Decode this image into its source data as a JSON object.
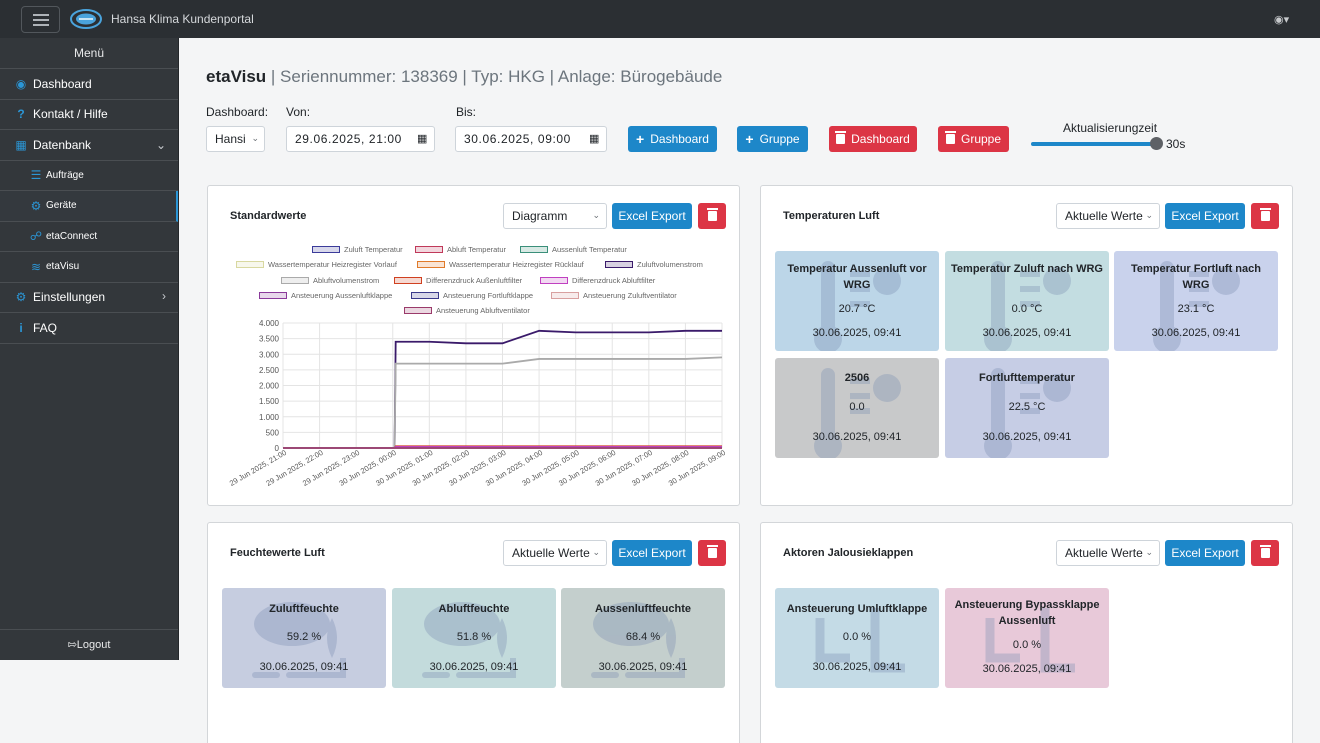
{
  "app": {
    "title": "Hansa Klima Kundenportal"
  },
  "sidebar": {
    "menu_label": "Menü",
    "items": [
      {
        "label": "Dashboard",
        "icon": "tachometer-icon"
      },
      {
        "label": "Kontakt / Hilfe",
        "icon": "question-icon"
      },
      {
        "label": "Datenbank",
        "icon": "database-icon"
      },
      {
        "label": "Aufträge",
        "icon": "list-icon"
      },
      {
        "label": "Geräte",
        "icon": "device-icon"
      },
      {
        "label": "etaConnect",
        "icon": "connect-icon"
      },
      {
        "label": "etaVisu",
        "icon": "chart-icon"
      },
      {
        "label": "Einstellungen",
        "icon": "gears-icon"
      },
      {
        "label": "FAQ",
        "icon": "info-icon"
      }
    ],
    "logout": "Logout"
  },
  "header": {
    "title_main": "etaVisu",
    "title_rest": " | Seriennummer: 138369 | Typ: HKG | Anlage: Bürogebäude"
  },
  "toolbar": {
    "dashboard_label": "Dashboard:",
    "dashboard_value": "Hansi",
    "from_label": "Von:",
    "from_value": "29.06.2025, 21:00",
    "to_label": "Bis:",
    "to_value": "30.06.2025, 09:00",
    "add_dashboard": "Dashboard",
    "add_group": "Gruppe",
    "del_dashboard": "Dashboard",
    "del_group": "Gruppe",
    "refresh_label": "Aktualisierungzeit",
    "refresh_value": "30s",
    "refresh_level": 1.0
  },
  "panels": {
    "standard": {
      "title": "Standardwerte",
      "view": "Diagramm",
      "export": "Excel Export"
    },
    "temp": {
      "title": "Temperaturen Luft",
      "view": "Aktuelle Werte",
      "export": "Excel Export"
    },
    "humidity": {
      "title": "Feuchtewerte Luft",
      "view": "Aktuelle Werte",
      "export": "Excel Export"
    },
    "actors": {
      "title": "Aktoren Jalousieklappen",
      "view": "Aktuelle Werte",
      "export": "Excel Export"
    }
  },
  "temp_cards": [
    {
      "title": "Temperatur Aussenluft vor WRG",
      "value": "20.7 °C",
      "date": "30.06.2025, 09:41",
      "color": "#bcd6e8"
    },
    {
      "title": "Temperatur Zuluft nach WRG",
      "value": "0.0 °C",
      "date": "30.06.2025, 09:41",
      "color": "#c3dde1"
    },
    {
      "title": "Temperatur Fortluft nach WRG",
      "value": "23.1 °C",
      "date": "30.06.2025, 09:41",
      "color": "#c9d2ec"
    },
    {
      "title": "2506",
      "value": "0.0",
      "date": "30.06.2025, 09:41",
      "color": "#c8c9ca"
    },
    {
      "title": "Fortlufttemperatur",
      "value": "22.5 °C",
      "date": "30.06.2025, 09:41",
      "color": "#c6cde5"
    }
  ],
  "humidity_cards": [
    {
      "title": "Zuluftfeuchte",
      "value": "59.2 %",
      "date": "30.06.2025, 09:41",
      "color": "#c6cde0"
    },
    {
      "title": "Abluftfeuchte",
      "value": "51.8 %",
      "date": "30.06.2025, 09:41",
      "color": "#c3dbdc"
    },
    {
      "title": "Aussenluftfeuchte",
      "value": "68.4 %",
      "date": "30.06.2025, 09:41",
      "color": "#c4cfcd"
    }
  ],
  "actor_cards": [
    {
      "title": "Ansteuerung Umluftklappe",
      "value": "0.0 %",
      "date": "30.06.2025, 09:41",
      "color": "#c4dbe6"
    },
    {
      "title": "Ansteuerung Bypassklappe Aussenluft",
      "value": "0.0 %",
      "date": "30.06.2025, 09:41",
      "color": "#e8c9d9"
    }
  ],
  "chart_data": {
    "type": "line",
    "x": [
      "29 Jun 2025, 21:00",
      "29 Jun 2025, 22:00",
      "29 Jun 2025, 23:00",
      "30 Jun 2025, 00:00",
      "30 Jun 2025, 01:00",
      "30 Jun 2025, 02:00",
      "30 Jun 2025, 03:00",
      "30 Jun 2025, 04:00",
      "30 Jun 2025, 05:00",
      "30 Jun 2025, 06:00",
      "30 Jun 2025, 07:00",
      "30 Jun 2025, 08:00",
      "30 Jun 2025, 09:00"
    ],
    "ylim": [
      0,
      4000
    ],
    "yticks": [
      "4.000",
      "3.500",
      "3.000",
      "2.500",
      "2.000",
      "1.500",
      "1.000",
      "500",
      "0"
    ],
    "grid": true,
    "legend_position": "top",
    "series": [
      {
        "name": "Zuluft Temperatur",
        "color": "#3b3b9a",
        "values": [
          0,
          0,
          0,
          0,
          20,
          20,
          20,
          20,
          20,
          20,
          20,
          20,
          20
        ]
      },
      {
        "name": "Abluft Temperatur",
        "color": "#c0395a",
        "values": [
          0,
          0,
          0,
          0,
          22,
          22,
          22,
          22,
          22,
          22,
          22,
          22,
          22
        ]
      },
      {
        "name": "Aussenluft Temperatur",
        "color": "#3a8f7a",
        "values": [
          0,
          0,
          0,
          0,
          21,
          21,
          21,
          21,
          21,
          21,
          21,
          21,
          21
        ]
      },
      {
        "name": "Wassertemperatur Heizregister Vorlauf",
        "color": "#d8d8a0",
        "values": [
          0,
          0,
          0,
          0,
          0,
          0,
          0,
          0,
          0,
          0,
          0,
          0,
          0
        ]
      },
      {
        "name": "Wassertemperatur Heizregister Rücklauf",
        "color": "#e07a2a",
        "values": [
          0,
          0,
          0,
          0,
          0,
          0,
          0,
          0,
          0,
          0,
          0,
          0,
          0
        ]
      },
      {
        "name": "Zuluftvolumenstrom",
        "color": "#3a1a6a",
        "values": [
          0,
          0,
          0,
          0,
          3400,
          3350,
          3350,
          3750,
          3700,
          3700,
          3700,
          3750,
          3750
        ]
      },
      {
        "name": "Abluftvolumenstrom",
        "color": "#aaaaaa",
        "values": [
          0,
          0,
          0,
          0,
          2700,
          2700,
          2700,
          2850,
          2850,
          2850,
          2850,
          2850,
          2900
        ]
      },
      {
        "name": "Differenzdruck Außenluftfilter",
        "color": "#d04020",
        "values": [
          0,
          0,
          0,
          0,
          60,
          60,
          60,
          60,
          60,
          60,
          60,
          60,
          60
        ]
      },
      {
        "name": "Differenzdruck Abluftfilter",
        "color": "#c040c0",
        "values": [
          0,
          0,
          0,
          0,
          40,
          40,
          40,
          40,
          40,
          40,
          40,
          40,
          40
        ]
      },
      {
        "name": "Ansteuerung Aussenluftklappe",
        "color": "#8a3a9a",
        "values": [
          0,
          0,
          0,
          0,
          0,
          0,
          0,
          0,
          0,
          0,
          0,
          0,
          0
        ]
      },
      {
        "name": "Ansteuerung Fortluftklappe",
        "color": "#3a3a8a",
        "values": [
          0,
          0,
          0,
          0,
          0,
          0,
          0,
          0,
          0,
          0,
          0,
          0,
          0
        ]
      },
      {
        "name": "Ansteuerung Zuluftventilator",
        "color": "#d8a0a0",
        "values": [
          0,
          0,
          0,
          0,
          0,
          0,
          0,
          0,
          0,
          0,
          0,
          0,
          0
        ]
      },
      {
        "name": "Ansteuerung Abluftventilator",
        "color": "#9a3a6a",
        "values": [
          0,
          0,
          0,
          0,
          0,
          0,
          0,
          0,
          0,
          0,
          0,
          0,
          0
        ]
      }
    ]
  }
}
